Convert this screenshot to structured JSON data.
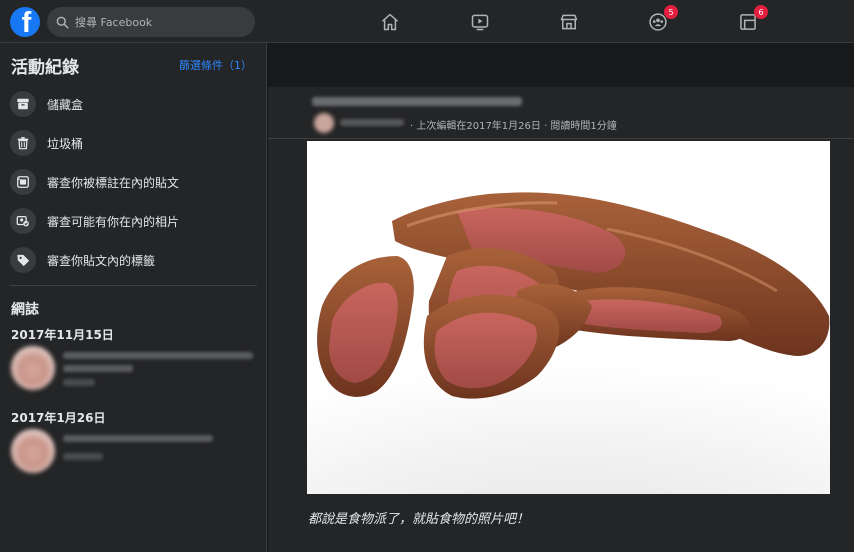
{
  "topbar": {
    "logo_letter": "f",
    "search_placeholder": "搜尋 Facebook",
    "nav": [
      {
        "icon": "home-icon"
      },
      {
        "icon": "watch-icon"
      },
      {
        "icon": "marketplace-icon"
      },
      {
        "icon": "groups-icon",
        "badge": "5"
      },
      {
        "icon": "gaming-icon",
        "badge": "6"
      }
    ],
    "badge_color": "#e41e3f",
    "brand_color": "#1877f2"
  },
  "sidebar": {
    "title": "活動紀錄",
    "filter_label": "篩選條件（1）",
    "items": [
      {
        "label": "儲藏盒",
        "icon": "archive-icon"
      },
      {
        "label": "垃圾桶",
        "icon": "trash-icon"
      },
      {
        "label": "審查你被標註在內的貼文",
        "icon": "tagged-posts-icon"
      },
      {
        "label": "審查可能有你在內的相片",
        "icon": "photo-review-icon"
      },
      {
        "label": "審查你貼文內的標籤",
        "icon": "tag-icon"
      }
    ],
    "log_title": "網誌",
    "entries": [
      {
        "date": "2017年11月15日"
      },
      {
        "date": "2017年1月26日"
      }
    ]
  },
  "post": {
    "meta": "· 上次編輯在2017年1月26日 · 閱讀時間1分鐘",
    "caption": "都說是食物派了，就貼食物的照片吧！"
  }
}
